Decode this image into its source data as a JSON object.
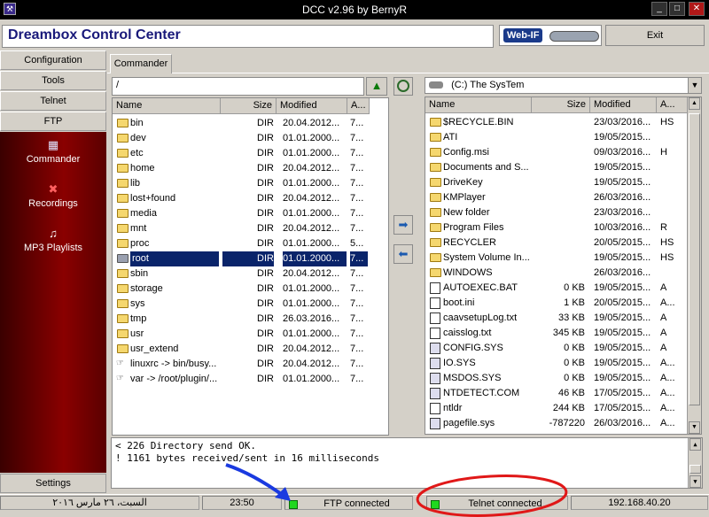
{
  "window": {
    "title": "DCC v2.96 by BernyR",
    "min": "_",
    "max": "□",
    "close": "✕"
  },
  "header": {
    "app_title": "Dreambox Control Center",
    "logo_text": "Web-IF",
    "exit_label": "Exit"
  },
  "sidebar": {
    "buttons": [
      "Configuration",
      "Tools",
      "Telnet",
      "FTP"
    ],
    "items": [
      {
        "label": "Commander",
        "icon": "grid-icon"
      },
      {
        "label": "Recordings",
        "icon": "recordings-icon"
      },
      {
        "label": "MP3 Playlists",
        "icon": "music-icon"
      }
    ],
    "settings_label": "Settings"
  },
  "tabs": [
    "Commander"
  ],
  "left": {
    "path": "/",
    "columns": [
      "Name",
      "Size",
      "Modified",
      "A..."
    ],
    "rows": [
      {
        "name": "bin",
        "size": "DIR",
        "modified": "20.04.2012...",
        "attr": "7...",
        "type": "folder"
      },
      {
        "name": "dev",
        "size": "DIR",
        "modified": "01.01.2000...",
        "attr": "7...",
        "type": "folder"
      },
      {
        "name": "etc",
        "size": "DIR",
        "modified": "01.01.2000...",
        "attr": "7...",
        "type": "folder"
      },
      {
        "name": "home",
        "size": "DIR",
        "modified": "20.04.2012...",
        "attr": "7...",
        "type": "folder"
      },
      {
        "name": "lib",
        "size": "DIR",
        "modified": "01.01.2000...",
        "attr": "7...",
        "type": "folder"
      },
      {
        "name": "lost+found",
        "size": "DIR",
        "modified": "20.04.2012...",
        "attr": "7...",
        "type": "folder"
      },
      {
        "name": "media",
        "size": "DIR",
        "modified": "01.01.2000...",
        "attr": "7...",
        "type": "folder"
      },
      {
        "name": "mnt",
        "size": "DIR",
        "modified": "20.04.2012...",
        "attr": "7...",
        "type": "folder"
      },
      {
        "name": "proc",
        "size": "DIR",
        "modified": "01.01.2000...",
        "attr": "5...",
        "type": "folder"
      },
      {
        "name": "root",
        "size": "DIR",
        "modified": "01.01.2000...",
        "attr": "7...",
        "type": "folder",
        "selected": true
      },
      {
        "name": "sbin",
        "size": "DIR",
        "modified": "20.04.2012...",
        "attr": "7...",
        "type": "folder"
      },
      {
        "name": "storage",
        "size": "DIR",
        "modified": "01.01.2000...",
        "attr": "7...",
        "type": "folder"
      },
      {
        "name": "sys",
        "size": "DIR",
        "modified": "01.01.2000...",
        "attr": "7...",
        "type": "folder"
      },
      {
        "name": "tmp",
        "size": "DIR",
        "modified": "26.03.2016...",
        "attr": "7...",
        "type": "folder"
      },
      {
        "name": "usr",
        "size": "DIR",
        "modified": "01.01.2000...",
        "attr": "7...",
        "type": "folder"
      },
      {
        "name": "usr_extend",
        "size": "DIR",
        "modified": "20.04.2012...",
        "attr": "7...",
        "type": "folder"
      },
      {
        "name": "linuxrc -> bin/busy...",
        "size": "DIR",
        "modified": "20.04.2012...",
        "attr": "7...",
        "type": "link"
      },
      {
        "name": "var -> /root/plugin/...",
        "size": "DIR",
        "modified": "01.01.2000...",
        "attr": "7...",
        "type": "link"
      }
    ]
  },
  "right": {
    "drive": "(C:)  The SysTem",
    "columns": [
      "Name",
      "Size",
      "Modified",
      "A..."
    ],
    "rows": [
      {
        "name": "$RECYCLE.BIN",
        "size": "",
        "modified": "23/03/2016...",
        "attr": "HS",
        "type": "folder"
      },
      {
        "name": "ATI",
        "size": "",
        "modified": "19/05/2015...",
        "attr": "",
        "type": "folder"
      },
      {
        "name": "Config.msi",
        "size": "",
        "modified": "09/03/2016...",
        "attr": "H",
        "type": "folder"
      },
      {
        "name": "Documents and S...",
        "size": "",
        "modified": "19/05/2015...",
        "attr": "",
        "type": "folder"
      },
      {
        "name": "DriveKey",
        "size": "",
        "modified": "19/05/2015...",
        "attr": "",
        "type": "folder"
      },
      {
        "name": "KMPlayer",
        "size": "",
        "modified": "26/03/2016...",
        "attr": "",
        "type": "folder"
      },
      {
        "name": "New folder",
        "size": "",
        "modified": "23/03/2016...",
        "attr": "",
        "type": "folder"
      },
      {
        "name": "Program Files",
        "size": "",
        "modified": "10/03/2016...",
        "attr": "R",
        "type": "folder"
      },
      {
        "name": "RECYCLER",
        "size": "",
        "modified": "20/05/2015...",
        "attr": "HS",
        "type": "folder"
      },
      {
        "name": "System Volume In...",
        "size": "",
        "modified": "19/05/2015...",
        "attr": "HS",
        "type": "folder"
      },
      {
        "name": "WINDOWS",
        "size": "",
        "modified": "26/03/2016...",
        "attr": "",
        "type": "folder"
      },
      {
        "name": "AUTOEXEC.BAT",
        "size": "0 KB",
        "modified": "19/05/2015...",
        "attr": "A",
        "type": "file"
      },
      {
        "name": "boot.ini",
        "size": "1 KB",
        "modified": "20/05/2015...",
        "attr": "A...",
        "type": "file"
      },
      {
        "name": "caavsetupLog.txt",
        "size": "33 KB",
        "modified": "19/05/2015...",
        "attr": "A",
        "type": "file"
      },
      {
        "name": "caisslog.txt",
        "size": "345 KB",
        "modified": "19/05/2015...",
        "attr": "A",
        "type": "file"
      },
      {
        "name": "CONFIG.SYS",
        "size": "0 KB",
        "modified": "19/05/2015...",
        "attr": "A",
        "type": "sys"
      },
      {
        "name": "IO.SYS",
        "size": "0 KB",
        "modified": "19/05/2015...",
        "attr": "A...",
        "type": "sys"
      },
      {
        "name": "MSDOS.SYS",
        "size": "0 KB",
        "modified": "19/05/2015...",
        "attr": "A...",
        "type": "sys"
      },
      {
        "name": "NTDETECT.COM",
        "size": "46 KB",
        "modified": "17/05/2015...",
        "attr": "A...",
        "type": "sys"
      },
      {
        "name": "ntldr",
        "size": "244 KB",
        "modified": "17/05/2015...",
        "attr": "A...",
        "type": "file"
      },
      {
        "name": "pagefile.sys",
        "size": "-787220",
        "modified": "26/03/2016...",
        "attr": "A...",
        "type": "sys"
      }
    ]
  },
  "log": [
    "< 226 Directory send OK.",
    "! 1161 bytes received/sent in 16 milliseconds"
  ],
  "status": {
    "date": "السبت، ٢٦ مارس ٢٠١٦",
    "time": "23:50",
    "ftp": "FTP connected",
    "telnet": "Telnet connected",
    "ip": "192.168.40.20"
  },
  "colors": {
    "title_text": "#19197a",
    "sidebar_bg": "#8a0000",
    "selection": "#0a246a",
    "led_green": "#1fd81f",
    "annotation_blue": "#1a3ae0",
    "annotation_red": "#e01818"
  }
}
